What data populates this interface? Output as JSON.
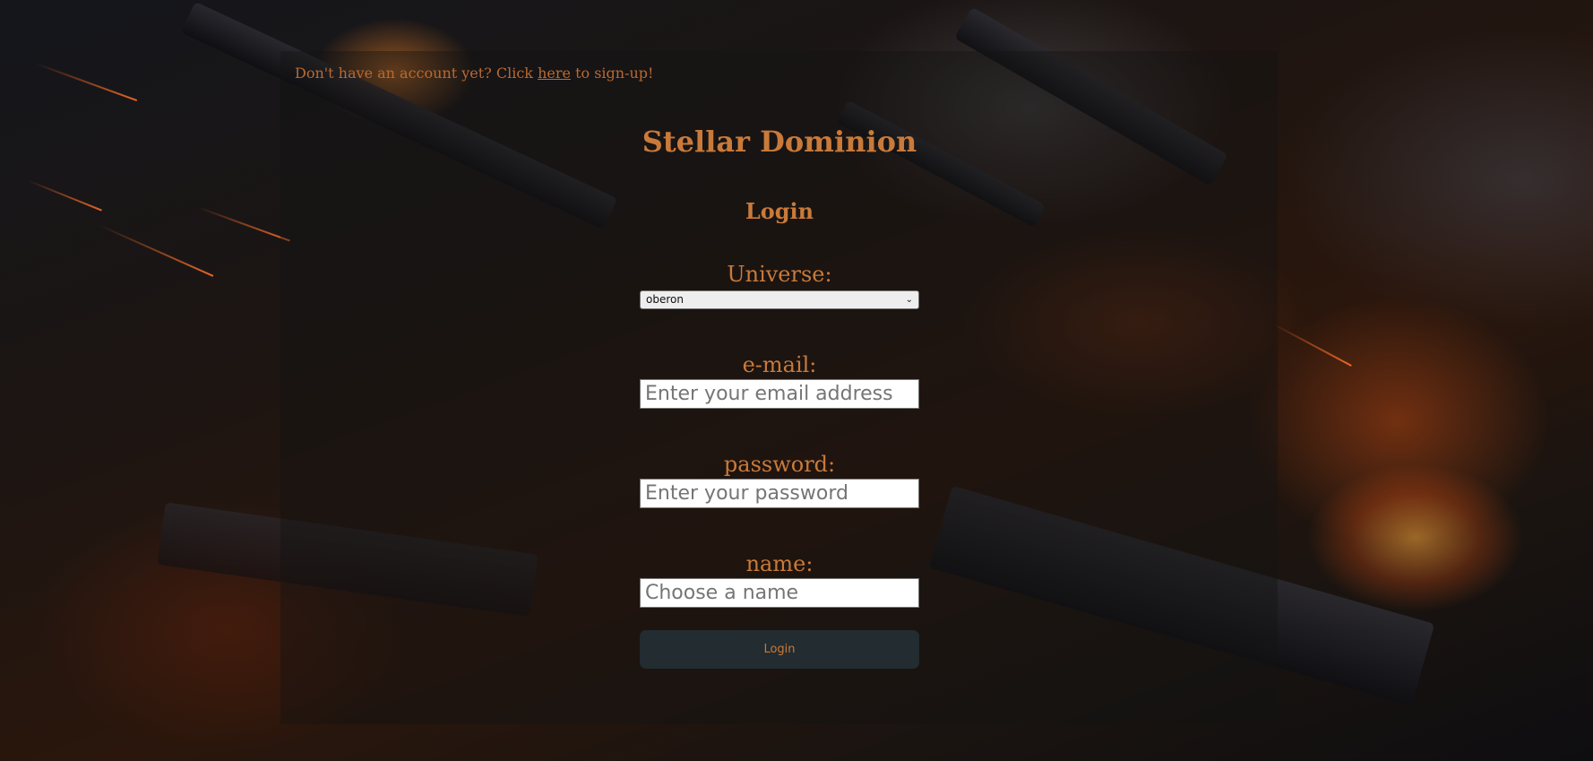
{
  "signup": {
    "prefix": "Don't have an account yet? Click ",
    "link": "here",
    "suffix": " to sign-up!"
  },
  "title": "Stellar Dominion",
  "subtitle": "Login",
  "form": {
    "universe_label": "Universe:",
    "universe_value": "oberon",
    "email_label": "e-mail:",
    "email_placeholder": "Enter your email address",
    "password_label": "password:",
    "password_placeholder": "Enter your password",
    "name_label": "name:",
    "name_placeholder": "Choose a name",
    "submit_label": "Login"
  },
  "colors": {
    "accent": "#c97a3a",
    "button_bg": "#222c31"
  }
}
